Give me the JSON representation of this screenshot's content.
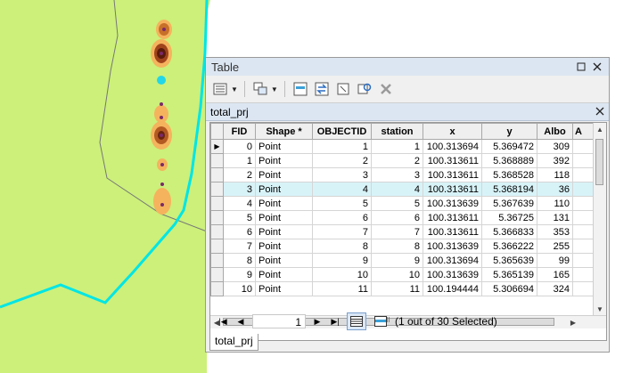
{
  "window": {
    "title": "Table"
  },
  "table_name": "total_prj",
  "bottom_tab": "total_prj",
  "columns": [
    "FID",
    "Shape *",
    "OBJECTID",
    "station",
    "x",
    "y",
    "Albo",
    "A"
  ],
  "rows": [
    {
      "fid": "0",
      "shape": "Point",
      "objectid": "1",
      "station": "1",
      "x": "100.313694",
      "y": "5.369472",
      "albo": "309",
      "current": true,
      "selected": false
    },
    {
      "fid": "1",
      "shape": "Point",
      "objectid": "2",
      "station": "2",
      "x": "100.313611",
      "y": "5.368889",
      "albo": "392",
      "current": false,
      "selected": false
    },
    {
      "fid": "2",
      "shape": "Point",
      "objectid": "3",
      "station": "3",
      "x": "100.313611",
      "y": "5.368528",
      "albo": "118",
      "current": false,
      "selected": false
    },
    {
      "fid": "3",
      "shape": "Point",
      "objectid": "4",
      "station": "4",
      "x": "100.313611",
      "y": "5.368194",
      "albo": "36",
      "current": false,
      "selected": true
    },
    {
      "fid": "4",
      "shape": "Point",
      "objectid": "5",
      "station": "5",
      "x": "100.313639",
      "y": "5.367639",
      "albo": "110",
      "current": false,
      "selected": false
    },
    {
      "fid": "5",
      "shape": "Point",
      "objectid": "6",
      "station": "6",
      "x": "100.313611",
      "y": "5.36725",
      "albo": "131",
      "current": false,
      "selected": false
    },
    {
      "fid": "6",
      "shape": "Point",
      "objectid": "7",
      "station": "7",
      "x": "100.313611",
      "y": "5.366833",
      "albo": "353",
      "current": false,
      "selected": false
    },
    {
      "fid": "7",
      "shape": "Point",
      "objectid": "8",
      "station": "8",
      "x": "100.313639",
      "y": "5.366222",
      "albo": "255",
      "current": false,
      "selected": false
    },
    {
      "fid": "8",
      "shape": "Point",
      "objectid": "9",
      "station": "9",
      "x": "100.313694",
      "y": "5.365639",
      "albo": "99",
      "current": false,
      "selected": false
    },
    {
      "fid": "9",
      "shape": "Point",
      "objectid": "10",
      "station": "10",
      "x": "100.313639",
      "y": "5.365139",
      "albo": "165",
      "current": false,
      "selected": false
    },
    {
      "fid": "10",
      "shape": "Point",
      "objectid": "11",
      "station": "11",
      "x": "100.194444",
      "y": "5.306694",
      "albo": "324",
      "current": false,
      "selected": false
    }
  ],
  "navigation": {
    "current_record": "1"
  },
  "status_text": "(1 out of 30 Selected)",
  "hscroll_mark": "III",
  "icons": {
    "current_row": "current-row-arrow-icon"
  },
  "colors": {
    "map_land": "#ccf07a",
    "map_boundary": "#00e5e5",
    "selection": "#d8f3f8",
    "title_bar": "#dce6f2"
  }
}
